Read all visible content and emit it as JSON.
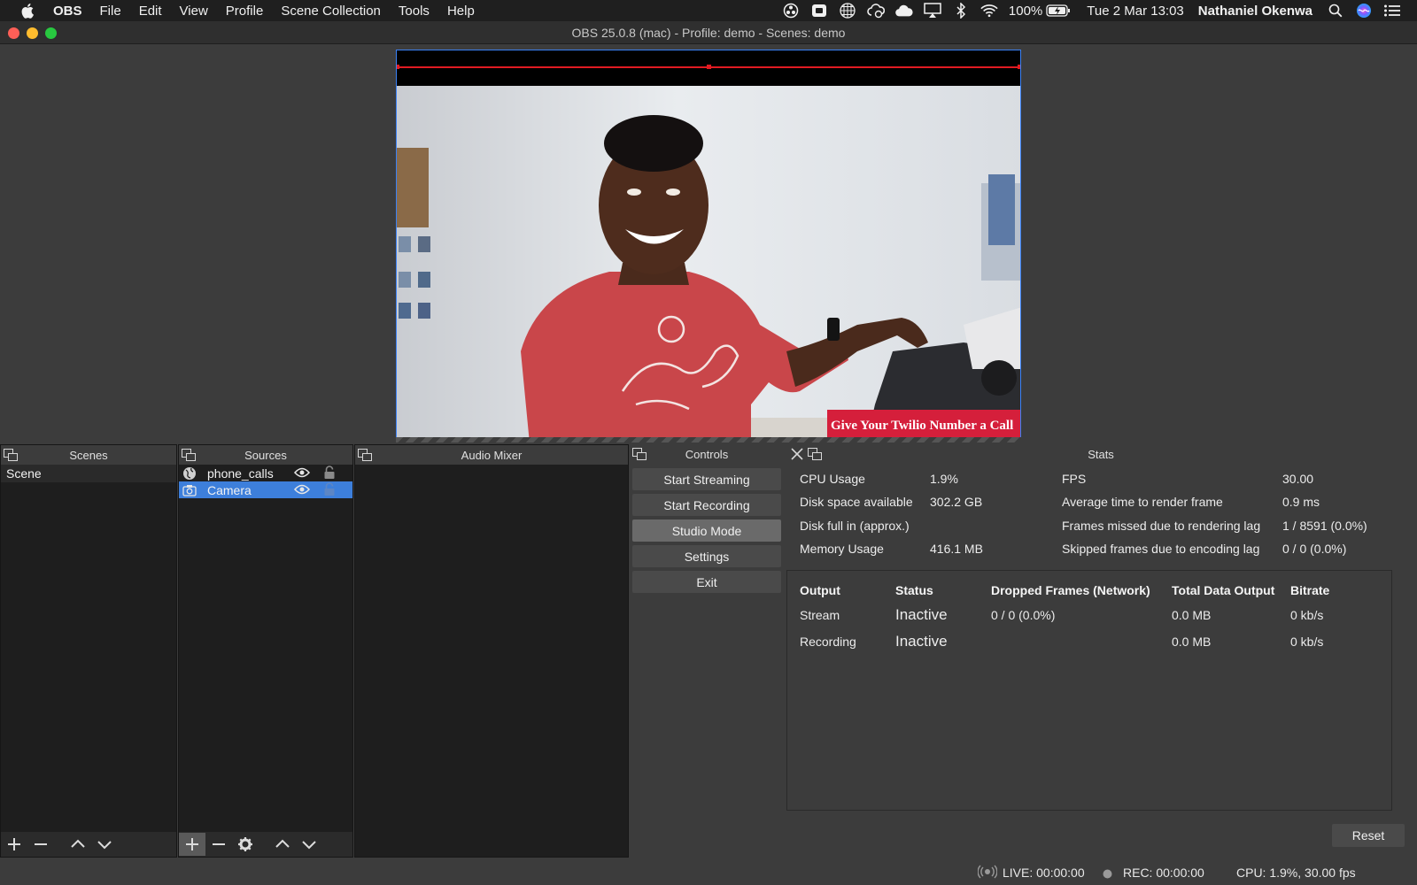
{
  "menubar": {
    "app_name": "OBS",
    "items": [
      "File",
      "Edit",
      "View",
      "Profile",
      "Scene Collection",
      "Tools",
      "Help"
    ],
    "battery": "100%",
    "datetime": "Tue 2 Mar  13:03",
    "user": "Nathaniel Okenwa",
    "tray_icons": [
      "obs-tray-icon",
      "record-icon",
      "grid-icon",
      "cloud-sync-icon",
      "cloud-icon",
      "airplay-icon",
      "bluetooth-icon",
      "wifi-icon"
    ]
  },
  "window": {
    "title": "OBS 25.0.8 (mac) - Profile: demo - Scenes: demo"
  },
  "preview": {
    "lower_third_text": "Give Your Twilio Number a Call",
    "colors": {
      "selection_border": "#3b82f6",
      "guide_line": "#e11b22",
      "lower_third": "#d51f3b"
    }
  },
  "scenes": {
    "title": "Scenes",
    "items": [
      "Scene"
    ]
  },
  "sources": {
    "title": "Sources",
    "items": [
      {
        "label": "phone_calls",
        "icon": "browser-globe-icon",
        "selected": false
      },
      {
        "label": "Camera",
        "icon": "camera-icon",
        "selected": true
      }
    ]
  },
  "mixer": {
    "title": "Audio Mixer"
  },
  "controls": {
    "title": "Controls",
    "buttons": [
      "Start Streaming",
      "Start Recording",
      "Studio Mode",
      "Settings",
      "Exit"
    ]
  },
  "stats": {
    "title": "Stats",
    "left": [
      {
        "label": "CPU Usage",
        "value": "1.9%"
      },
      {
        "label": "Disk space available",
        "value": "302.2 GB"
      },
      {
        "label": "Disk full in (approx.)",
        "value": ""
      },
      {
        "label": "Memory Usage",
        "value": "416.1 MB"
      }
    ],
    "right": [
      {
        "label": "FPS",
        "value": "30.00"
      },
      {
        "label": "Average time to render frame",
        "value": "0.9 ms"
      },
      {
        "label": "Frames missed due to rendering lag",
        "value": "1 / 8591 (0.0%)"
      },
      {
        "label": "Skipped frames due to encoding lag",
        "value": "0 / 0 (0.0%)"
      }
    ],
    "table": {
      "headers": [
        "Output",
        "Status",
        "Dropped Frames (Network)",
        "Total Data Output",
        "Bitrate"
      ],
      "rows": [
        [
          "Stream",
          "Inactive",
          "0 / 0 (0.0%)",
          "0.0 MB",
          "0 kb/s"
        ],
        [
          "Recording",
          "Inactive",
          "",
          "0.0 MB",
          "0 kb/s"
        ]
      ]
    },
    "reset_label": "Reset"
  },
  "statusbar": {
    "live": "LIVE: 00:00:00",
    "rec": "REC: 00:00:00",
    "cpu": "CPU: 1.9%, 30.00 fps"
  }
}
